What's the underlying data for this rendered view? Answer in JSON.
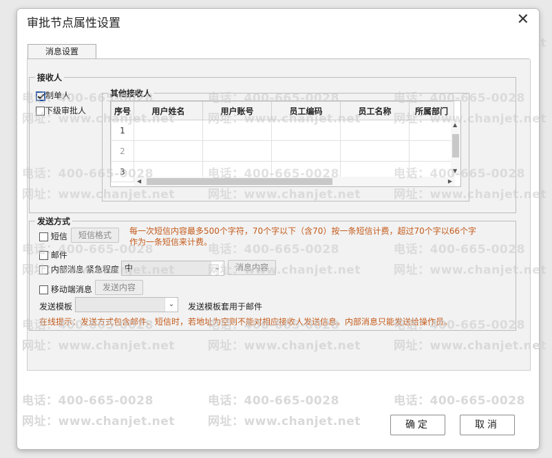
{
  "dialog": {
    "title": "审批节点属性设置",
    "close_glyph": "✕"
  },
  "watermark": {
    "phone": "电话：400-665-0028",
    "site": "网址：www.chanjet.net"
  },
  "tab": {
    "label": "消息设置"
  },
  "recipients": {
    "legend": "接收人",
    "creator": {
      "label": "制单人",
      "checked": true
    },
    "next_approver": {
      "label": "下级审批人",
      "checked": false
    },
    "other": {
      "legend": "其他接收人",
      "columns": [
        "序号",
        "用户姓名",
        "用户账号",
        "员工编码",
        "员工名称",
        "所属部门"
      ],
      "rows": [
        [
          "1"
        ],
        [
          "2"
        ],
        [
          "3"
        ]
      ]
    }
  },
  "send": {
    "legend": "发送方式",
    "sms": {
      "label": "短信",
      "checked": false,
      "format_button": "短信格式"
    },
    "sms_note": [
      "每一次短信内容最多500个字符，70个字以下（含70）按一条短信计费，超过70个字以66个字",
      "作为一条短信来计费。"
    ],
    "email": {
      "label": "邮件",
      "checked": false
    },
    "internal": {
      "label": "内部消息",
      "urgency_label": "紧急程度",
      "urgency_value": "中",
      "content_button": "消息内容",
      "checked": false
    },
    "mobile": {
      "label": "移动端消息",
      "content_button": "发送内容",
      "checked": false
    },
    "template": {
      "label": "发送模板",
      "value": "",
      "hint": "发送模板套用于邮件"
    },
    "tip": "在线提示：发送方式包含邮件、短信时，若地址为空则不能对相应接收人发送信息。内部消息只能发送给操作员。"
  },
  "footer": {
    "ok": "确定",
    "cancel": "取消"
  }
}
